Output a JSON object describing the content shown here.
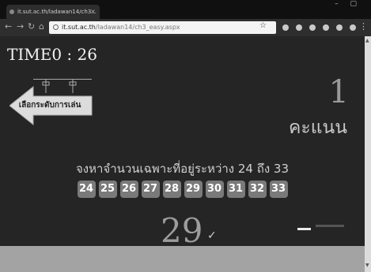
{
  "browser": {
    "tab_title": "it.sut.ac.th/ladawan14/ch3...",
    "tab_close": "×",
    "url_domain": "it.sut.ac.th",
    "url_path": "/ladawan14/ch3_easy.aspx"
  },
  "game": {
    "timer": "TIME0 : 26",
    "back_button_label": "เลือกระดับการเล่น",
    "score_value": "1",
    "score_label": "คะแนน",
    "prompt": "จงหาจำนวนเฉพาะที่อยู่ระหว่าง  24  ถึง  33",
    "choices": [
      "24",
      "25",
      "26",
      "27",
      "28",
      "29",
      "30",
      "31",
      "32",
      "33"
    ],
    "selected_answer": "29",
    "check_mark": "✓"
  },
  "icons": {
    "back": "back-icon",
    "forward": "forward-icon",
    "reload": "reload-icon",
    "home": "home-icon",
    "star": "star-icon",
    "menu": "menu-icon"
  }
}
